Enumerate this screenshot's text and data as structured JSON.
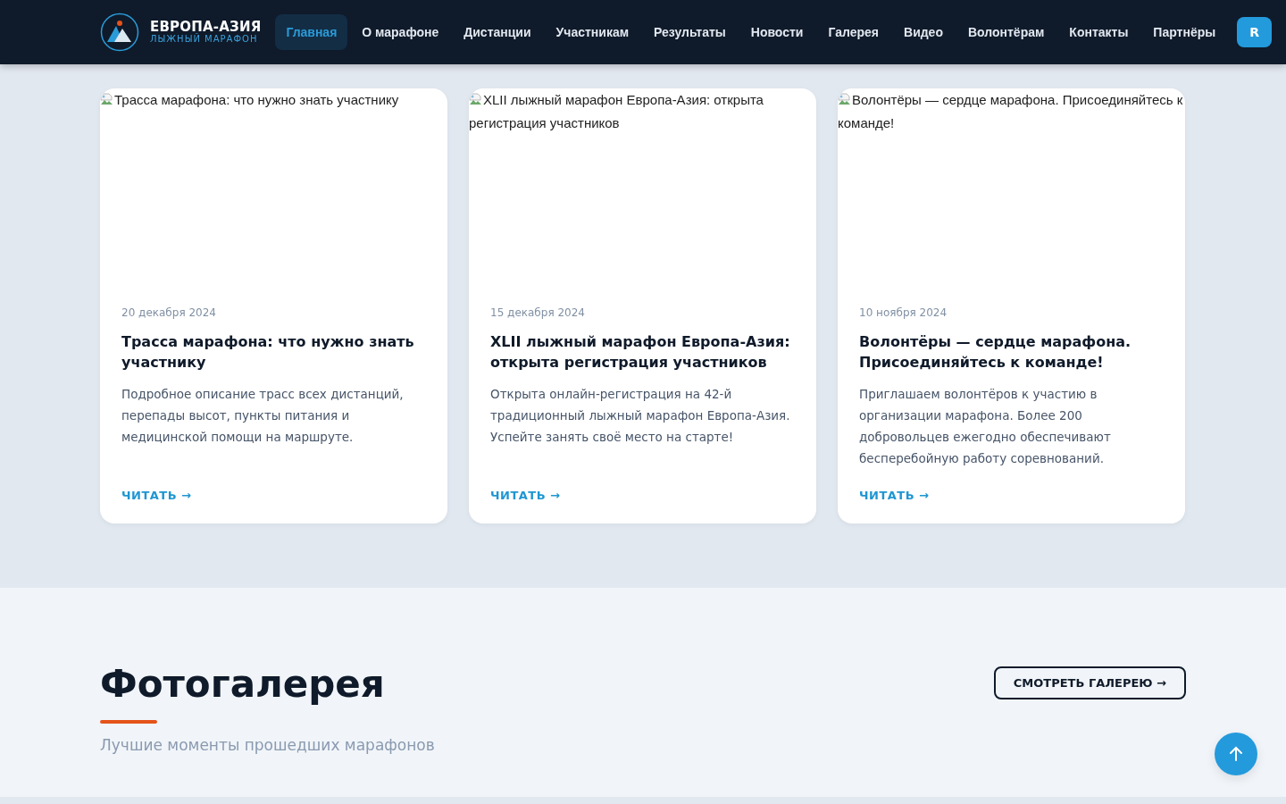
{
  "header": {
    "logo": {
      "title": "ЕВРОПА-АЗИЯ",
      "subtitle": "ЛЫЖНЫЙ МАРАФОН"
    },
    "nav": [
      {
        "label": "Главная",
        "selected": true
      },
      {
        "label": "О марафоне",
        "selected": false
      },
      {
        "label": "Дистанции",
        "selected": false
      },
      {
        "label": "Участникам",
        "selected": false
      },
      {
        "label": "Результаты",
        "selected": false
      },
      {
        "label": "Новости",
        "selected": false
      },
      {
        "label": "Галерея",
        "selected": false
      },
      {
        "label": "Видео",
        "selected": false
      },
      {
        "label": "Волонтёрам",
        "selected": false
      },
      {
        "label": "Контакты",
        "selected": false
      },
      {
        "label": "Партнёры",
        "selected": false
      }
    ],
    "cta": "R"
  },
  "news": [
    {
      "image_alt": "Трасса марафона: что нужно знать участнику",
      "date": "20 декабря 2024",
      "title": "Трасса марафона: что нужно знать участнику",
      "text": "Подробное описание трасс всех дистанций, перепады высот, пункты питания и медицинской помощи на маршруте.",
      "link": "ЧИТАТЬ →"
    },
    {
      "image_alt": "XLII лыжный марафон Европа-Азия: открыта регистрация участников",
      "date": "15 декабря 2024",
      "title": "XLII лыжный марафон Европа-Азия: открыта регистрация участников",
      "text": "Открыта онлайн-регистрация на 42-й традиционный лыжный марафон Европа-Азия. Успейте занять своё место на старте!",
      "link": "ЧИТАТЬ →"
    },
    {
      "image_alt": "Волонтёры — сердце марафона. Присоединяйтесь к команде!",
      "date": "10 ноября 2024",
      "title": "Волонтёры — сердце марафона. Присоединяйтесь к команде!",
      "text": "Приглашаем волонтёров к участию в организации марафона. Более 200 добровольцев ежегодно обеспечивают бесперебойную работу соревнований.",
      "link": "ЧИТАТЬ →"
    }
  ],
  "gallery": {
    "title": "Фотогалерея",
    "subtitle": "Лучшие моменты прошедших марафонов",
    "button": "СМОТРЕТЬ ГАЛЕРЕЮ →"
  }
}
